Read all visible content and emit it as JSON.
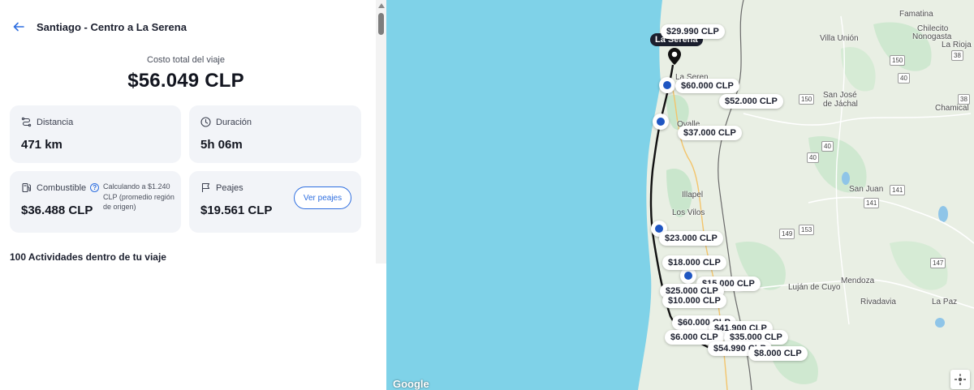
{
  "header": {
    "back_icon": "arrow-left-icon",
    "title": "Santiago - Centro a La Serena"
  },
  "summary": {
    "total_label": "Costo total del viaje",
    "total_value": "$56.049 CLP"
  },
  "cards": {
    "distance": {
      "label": "Distancia",
      "value": "471 km",
      "icon": "route-icon"
    },
    "duration": {
      "label": "Duración",
      "value": "5h 06m",
      "icon": "clock-icon"
    },
    "fuel": {
      "label": "Combustible",
      "value": "$36.488 CLP",
      "note": "Calculando a $1.240 CLP (promedio región de origen)",
      "icon": "fuel-pump-icon",
      "info_icon": "info-icon"
    },
    "tolls": {
      "label": "Peajes",
      "value": "$19.561 CLP",
      "button": "Ver peajes",
      "icon": "flag-icon"
    }
  },
  "activities_label": "100 Actividades dentro de tu viaje",
  "map": {
    "destination_label": "La Serena",
    "places": {
      "famatina": "Famatina",
      "chilecito": "Chilecito",
      "nonogasta": "Nonogasta",
      "villa_union": "Villa Unión",
      "la_rioja": "La Rioja",
      "san_jose": "San José",
      "de_jachal": "de Jáchal",
      "chamical": "Chamical",
      "la_serena_map": "La Seren",
      "ovalle": "Ovalle",
      "san_juan": "San Juan",
      "illapel": "Illapel",
      "los_vilos": "Los Vilos",
      "mendoza": "Mendoza",
      "lujan": "Luján de Cuyo",
      "rivadavia": "Rivadavia",
      "la_paz": "La Paz"
    },
    "routes": {
      "r150a": "150",
      "r150b": "150",
      "r40a": "40",
      "r40b": "40",
      "r40c": "40",
      "r141a": "141",
      "r141b": "141",
      "r149": "149",
      "r153": "153",
      "r147": "147",
      "r38a": "38",
      "r38b": "38"
    },
    "prices": {
      "p1": "$29.990 CLP",
      "p2": "$60.000 CLP",
      "p3": "$52.000 CLP",
      "p4": "$37.000 CLP",
      "p5": "$23.000 CLP",
      "p6": "$18.000 CLP",
      "p7": "$15.000 CLP",
      "p8": "$25.000 CLP",
      "p9": "$10.000 CLP",
      "p10": "$60.000 CLP",
      "p11": "$41.900 CLP",
      "p12": "$6.000 CLP",
      "p13": "$35.000 CLP",
      "p14": "$54.990 CLP",
      "p15": "$8.000 CLP"
    },
    "google_logo": "Google",
    "recenter_icon": "recenter-icon",
    "colors": {
      "ocean": "#7fd2e8",
      "land": "#e9efe4",
      "green": "#bfe0c4",
      "route": "#111111",
      "accent": "#2f6fe0"
    }
  }
}
